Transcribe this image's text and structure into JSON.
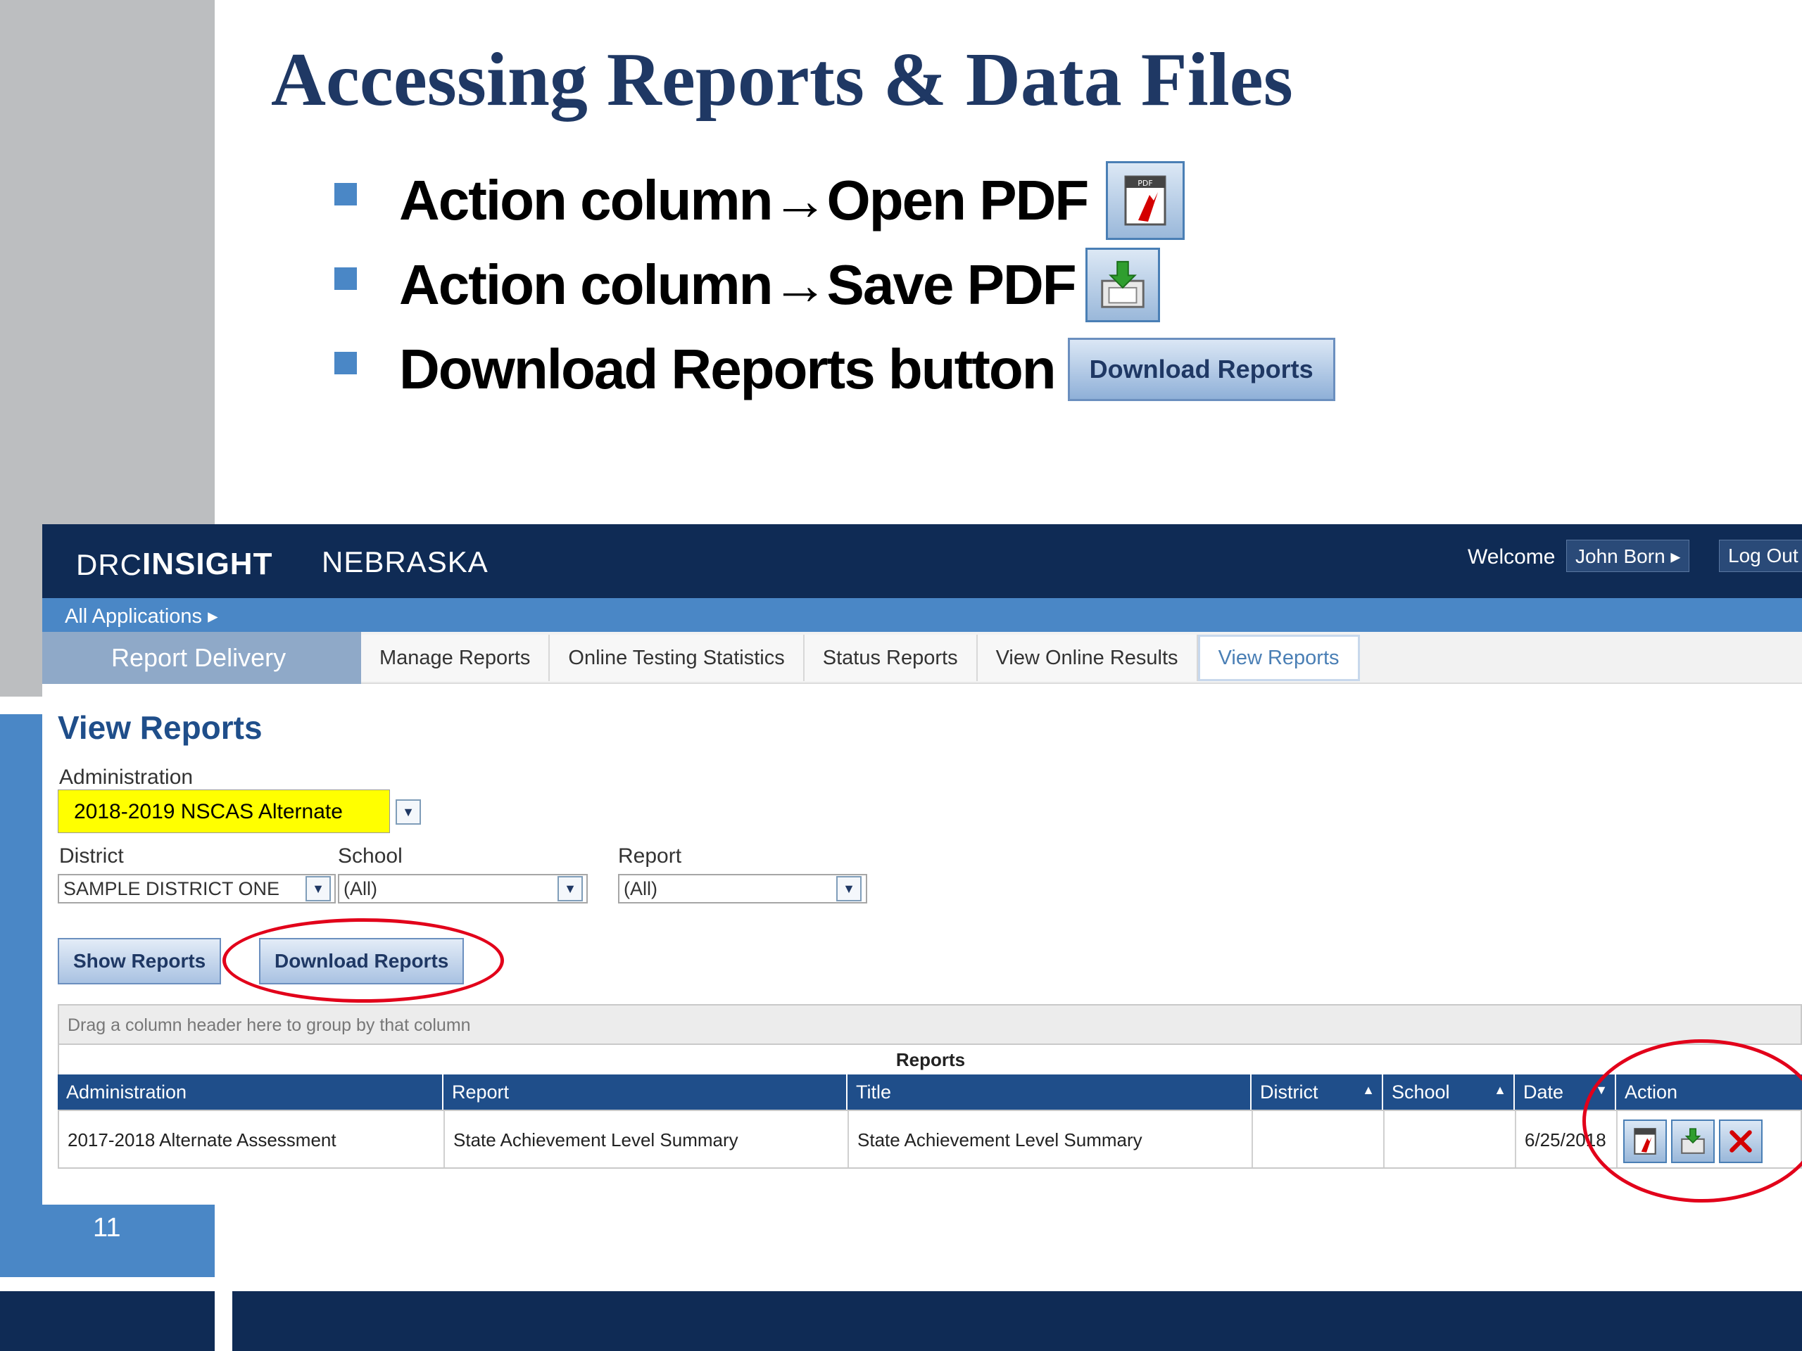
{
  "slide": {
    "title": "Accessing Reports & Data Files",
    "page_number": "11",
    "bullets": [
      {
        "text": "Action column→Open PDF",
        "icon": "pdf-open-icon"
      },
      {
        "text": "Action column→Save PDF",
        "icon": "save-pdf-icon"
      },
      {
        "text": "Download Reports button",
        "button_label": "Download Reports"
      }
    ]
  },
  "app": {
    "logo_drc": "DRC",
    "logo_insight": "INSIGHT",
    "state": "NEBRASKA",
    "welcome": "Welcome",
    "user_name": "John Born ▸",
    "logout": "Log Out",
    "all_applications": "All Applications ▸",
    "module_title": "Report Delivery",
    "tabs": [
      {
        "label": "Manage Reports",
        "active": false
      },
      {
        "label": "Online Testing Statistics",
        "active": false
      },
      {
        "label": "Status Reports",
        "active": false
      },
      {
        "label": "View Online Results",
        "active": false
      },
      {
        "label": "View Reports",
        "active": true
      }
    ]
  },
  "view_reports": {
    "title": "View Reports",
    "administration_label": "Administration",
    "administration_value": "2018-2019 NSCAS Alternate",
    "district_label": "District",
    "district_value": "SAMPLE DISTRICT ONE",
    "school_label": "School",
    "school_value": "(All)",
    "report_label": "Report",
    "report_value": "(All)",
    "show_reports": "Show Reports",
    "download_reports": "Download Reports"
  },
  "grid": {
    "group_hint": "Drag a column header here to group by that column",
    "caption": "Reports",
    "columns": [
      "Administration",
      "Report",
      "Title",
      "District",
      "School",
      "Date",
      "Action"
    ],
    "rows": [
      {
        "administration": "2017-2018 Alternate Assessment",
        "report": "State Achievement Level Summary",
        "title": "State Achievement Level Summary",
        "district": "",
        "school": "",
        "date": "6/25/2018"
      }
    ]
  },
  "colors": {
    "navy": "#0f2b55",
    "accent_blue": "#4a87c6",
    "title_blue": "#1f3864",
    "highlight_yellow": "#ffff00",
    "annotation_red": "#e2001a"
  }
}
